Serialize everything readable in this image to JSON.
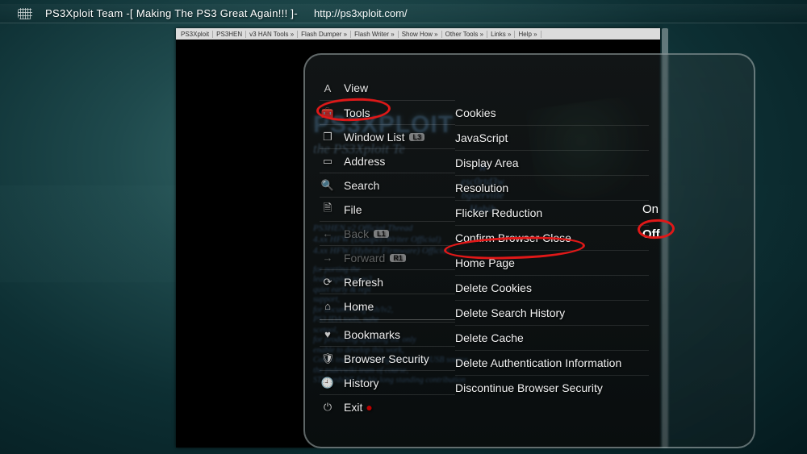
{
  "header": {
    "icon_name": "www-icon",
    "title": "PS3Xploit Team -[ Making The PS3 Great Again!!! ]-",
    "url": "http://ps3xploit.com/"
  },
  "site_tabs": [
    "PS3Xploit",
    "PS3HEN",
    "v3 HAN Tools »",
    "Flash Dumper »",
    "Flash Writer »",
    "Show How »",
    "Other Tools »",
    "Links »",
    "Help »"
  ],
  "bg": {
    "logo": "PS3XPLOIT",
    "sub": "the PS3Xploit Te",
    "names": [
      "W",
      "esc0rtd3w",
      "bguerville",
      "Habib"
    ],
    "threads": [
      "PS3HEN v2 Official Thread",
      "4.xx HFW (Dumper/Writer Official)",
      "4.xx HFW (Hybrid Firmware) Official"
    ],
    "thanks": [
      "for porting the",
      "leak exploit to ps3,",
      "quiet early & repl",
      "support,",
      "for documenting vsh/lv2,",
      "PS3 IDA tools, nahe",
      "scetool,",
      "for producing/updating the only",
      "enable to develop this work,",
      "Cobra team for sharing their CobraUSB source,",
      "the psdevwiki team of course,",
      "STLcardsWS for his long standing contribution"
    ]
  },
  "main_menu": [
    {
      "icon": "A",
      "label": "View",
      "badge": ""
    },
    {
      "icon": "toolbox",
      "label": "Tools",
      "badge": ""
    },
    {
      "icon": "windows",
      "label": "Window List",
      "badge": "L3"
    },
    {
      "icon": "page",
      "label": "Address",
      "badge": ""
    },
    {
      "icon": "search",
      "label": "Search",
      "badge": ""
    },
    {
      "icon": "file",
      "label": "File",
      "badge": ""
    },
    {
      "icon": "back",
      "label": "Back",
      "dim": true,
      "badge": "L1"
    },
    {
      "icon": "fwd",
      "label": "Forward",
      "dim": true,
      "badge": "R1"
    },
    {
      "icon": "refresh",
      "label": "Refresh",
      "badge": ""
    },
    {
      "icon": "home",
      "label": "Home",
      "badge": ""
    },
    {
      "sep": true
    },
    {
      "icon": "heart",
      "label": "Bookmarks",
      "badge": ""
    },
    {
      "icon": "shield",
      "label": "Browser Security",
      "badge": ""
    },
    {
      "icon": "clock",
      "label": "History",
      "badge": ""
    },
    {
      "icon": "exit",
      "label": "Exit",
      "badge": "●"
    }
  ],
  "sub_menu": [
    "Cookies",
    "JavaScript",
    "Display Area",
    "Resolution",
    "Flicker Reduction",
    "Confirm Browser Close",
    "Home Page",
    "Delete Cookies",
    "Delete Search History",
    "Delete Cache",
    "Delete Authentication Information",
    "Discontinue Browser Security"
  ],
  "options": {
    "on": "On",
    "off": "Off",
    "selected": "off"
  },
  "highlights": [
    "tools",
    "confirm-browser-close",
    "off"
  ]
}
